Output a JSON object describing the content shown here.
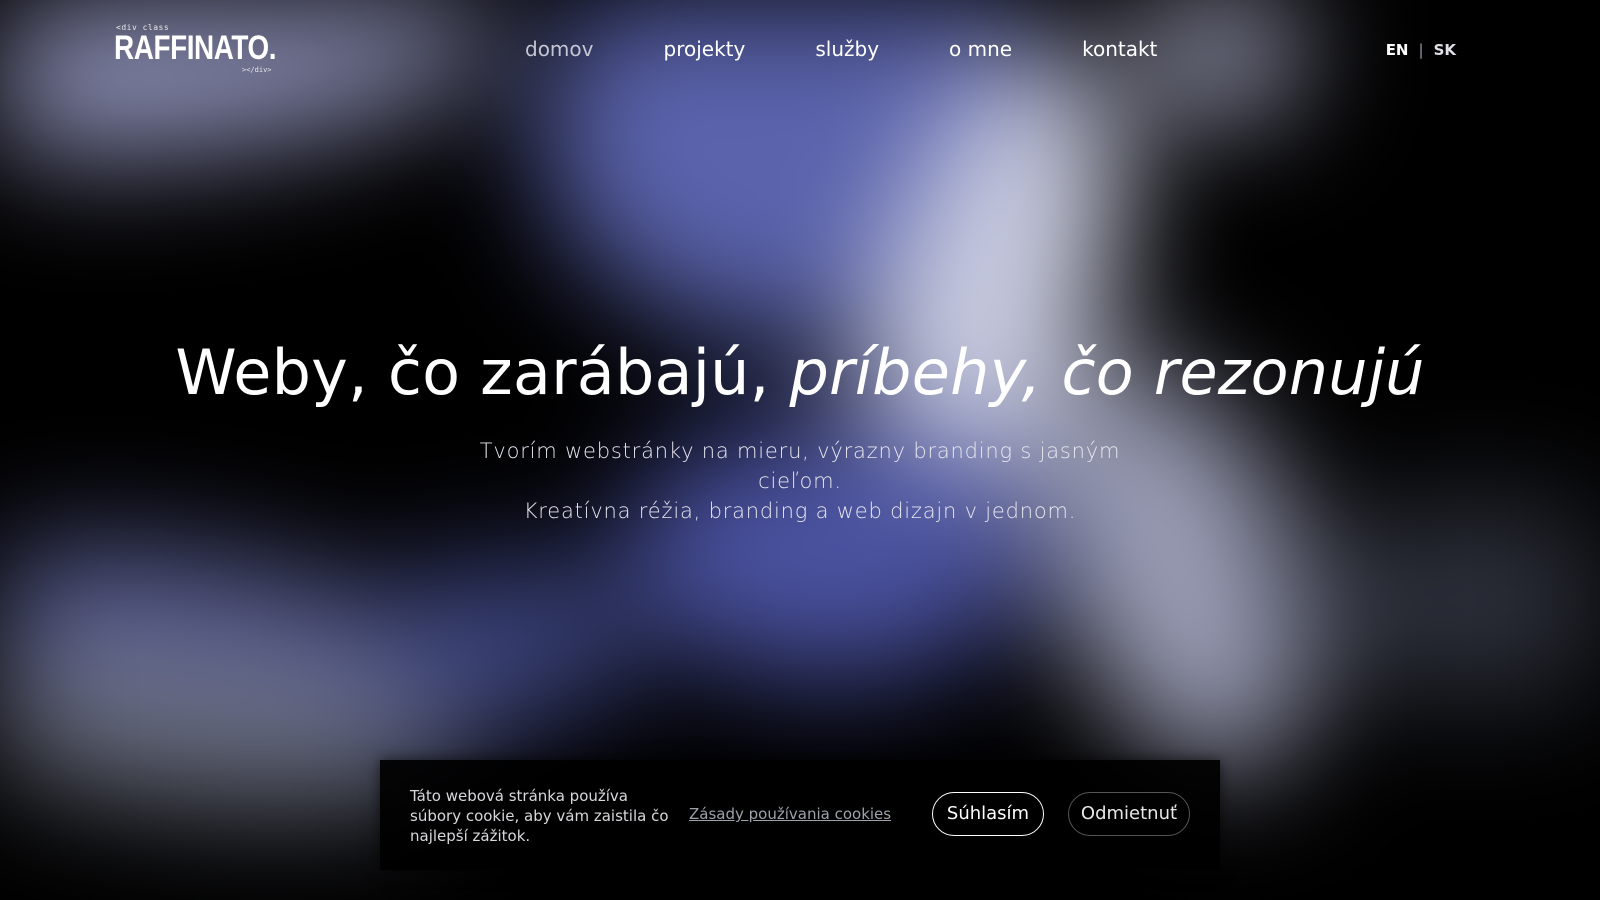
{
  "logo": {
    "top_code": "<div class",
    "name": "RAFFINATO.",
    "bottom_code": "></div>"
  },
  "nav": {
    "items": [
      {
        "label": "domov",
        "active": true
      },
      {
        "label": "projekty",
        "active": false
      },
      {
        "label": "služby",
        "active": false
      },
      {
        "label": "o mne",
        "active": false
      },
      {
        "label": "kontakt",
        "active": false
      }
    ]
  },
  "language": {
    "options": [
      "EN",
      "SK"
    ],
    "separator": "|"
  },
  "hero": {
    "title_plain": "Weby, čo zarábajú, ",
    "title_italic": "príbehy, čo rezonujú",
    "subtitle_line1": "Tvorím webstránky na mieru, výrazny branding s jasným cieľom.",
    "subtitle_line2": "Kreatívna réžia, branding a web dizajn v jednom."
  },
  "cookie_banner": {
    "text": "Táto webová stránka používa súbory cookie, aby vám zaistila čo najlepší zážitok.",
    "policy_link": "Zásady používania cookies",
    "accept_label": "Súhlasím",
    "decline_label": "Odmietnuť"
  },
  "colors": {
    "background": "#000000",
    "accent_blue": "#5a63ac",
    "text": "#ffffff",
    "nav_active": "#c4c6d4"
  }
}
